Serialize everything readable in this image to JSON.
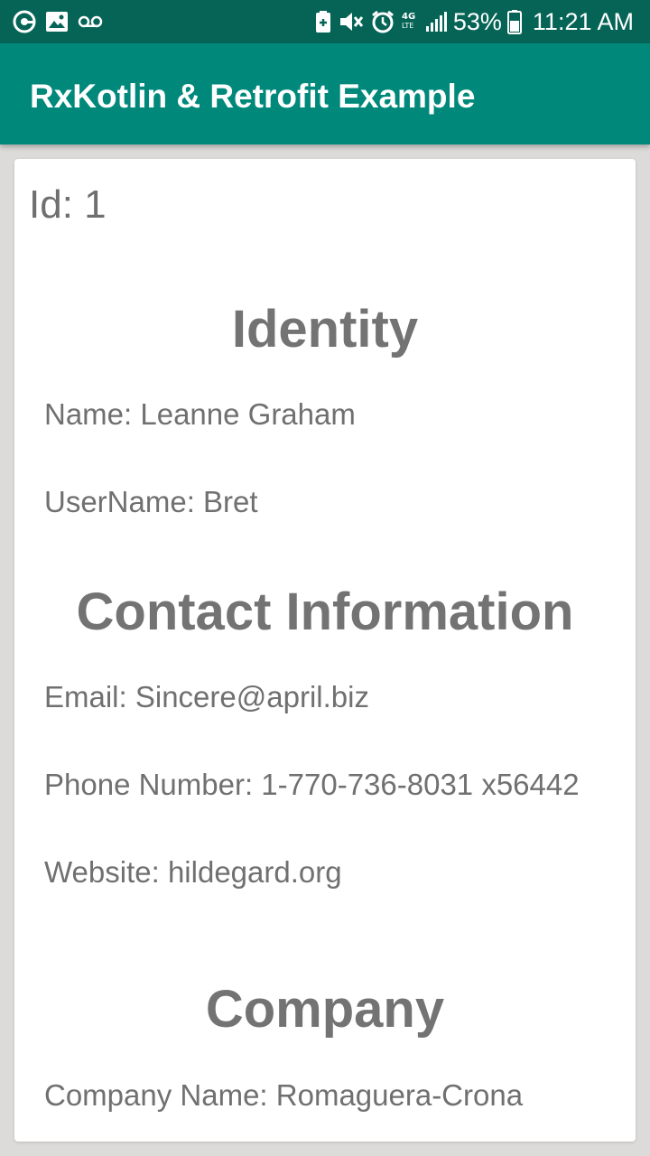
{
  "status_bar": {
    "battery_percent": "53%",
    "time": "11:21 AM",
    "network_label": "4G LTE",
    "left_icons": [
      "app-notification-icon",
      "image-icon",
      "voicemail-icon"
    ],
    "right_icons": [
      "battery-saver-icon",
      "mute-icon",
      "alarm-icon",
      "network-4g-icon",
      "signal-icon",
      "battery-icon"
    ]
  },
  "app_bar": {
    "title": "RxKotlin & Retrofit Example",
    "color": "#00897b"
  },
  "user": {
    "id_text": "Id: 1",
    "sections": {
      "identity": {
        "heading": "Identity",
        "name": "Name: Leanne Graham",
        "username": "UserName: Bret"
      },
      "contact": {
        "heading": "Contact Information",
        "email": "Email: Sincere@april.biz",
        "phone": "Phone Number: 1-770-736-8031 x56442",
        "website": "Website: hildegard.org"
      },
      "company": {
        "heading": "Company",
        "company_name": "Company Name: Romaguera-Crona"
      }
    }
  }
}
